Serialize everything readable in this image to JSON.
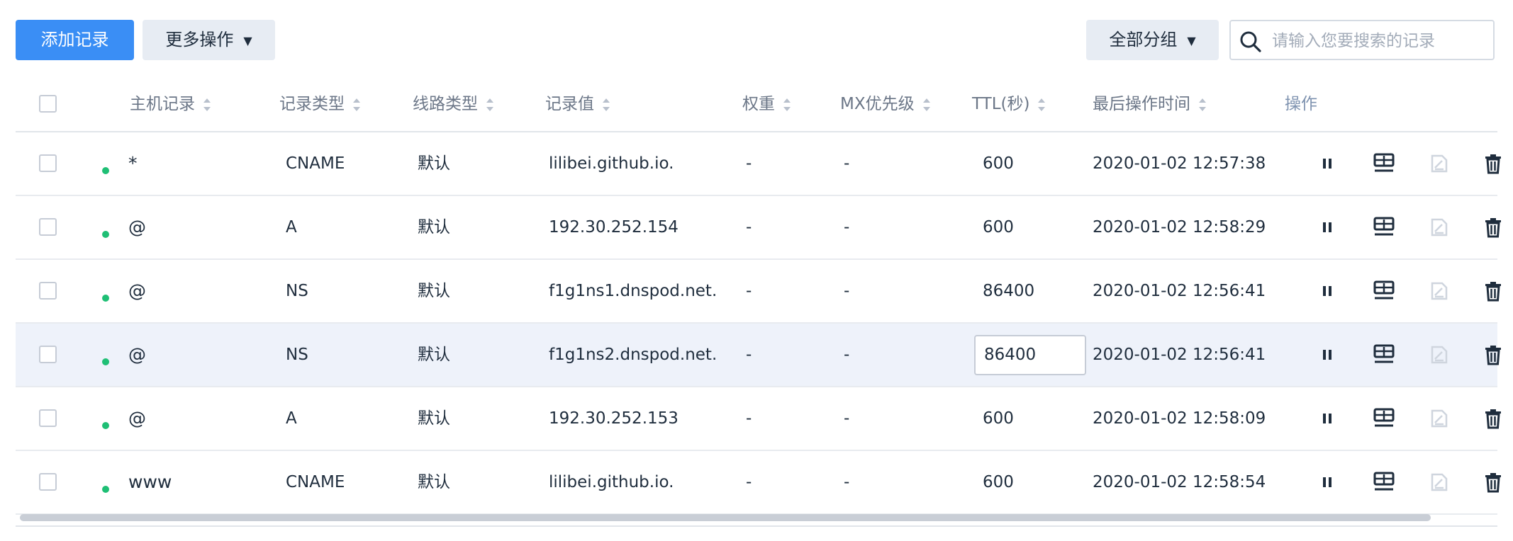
{
  "toolbar": {
    "add_label": "添加记录",
    "more_label": "更多操作",
    "group_label": "全部分组",
    "search_placeholder": "请输入您要搜索的记录"
  },
  "columns": {
    "host": "主机记录",
    "type": "记录类型",
    "line": "线路类型",
    "value": "记录值",
    "weight": "权重",
    "mx": "MX优先级",
    "ttl": "TTL(秒)",
    "time": "最后操作时间",
    "ops": "操作"
  },
  "colors": {
    "primary": "#3a8ef5",
    "status_green": "#1fbf75",
    "highlight_row": "#eef2fa"
  },
  "rows": [
    {
      "host": "*",
      "type": "CNAME",
      "line": "默认",
      "value": "lilibei.github.io.",
      "weight": "-",
      "mx": "-",
      "ttl": "600",
      "time": "2020-01-02 12:57:38"
    },
    {
      "host": "@",
      "type": "A",
      "line": "默认",
      "value": "192.30.252.154",
      "weight": "-",
      "mx": "-",
      "ttl": "600",
      "time": "2020-01-02 12:58:29"
    },
    {
      "host": "@",
      "type": "NS",
      "line": "默认",
      "value": "f1g1ns1.dnspod.net.",
      "weight": "-",
      "mx": "-",
      "ttl": "86400",
      "time": "2020-01-02 12:56:41"
    },
    {
      "host": "@",
      "type": "NS",
      "line": "默认",
      "value": "f1g1ns2.dnspod.net.",
      "weight": "-",
      "mx": "-",
      "ttl": "86400",
      "time": "2020-01-02 12:56:41"
    },
    {
      "host": "@",
      "type": "A",
      "line": "默认",
      "value": "192.30.252.153",
      "weight": "-",
      "mx": "-",
      "ttl": "600",
      "time": "2020-01-02 12:58:09"
    },
    {
      "host": "www",
      "type": "CNAME",
      "line": "默认",
      "value": "lilibei.github.io.",
      "weight": "-",
      "mx": "-",
      "ttl": "600",
      "time": "2020-01-02 12:58:54"
    }
  ],
  "icons": {
    "pause": "pause-icon",
    "remark": "remark-icon",
    "edit": "edit-icon",
    "delete": "delete-icon"
  }
}
